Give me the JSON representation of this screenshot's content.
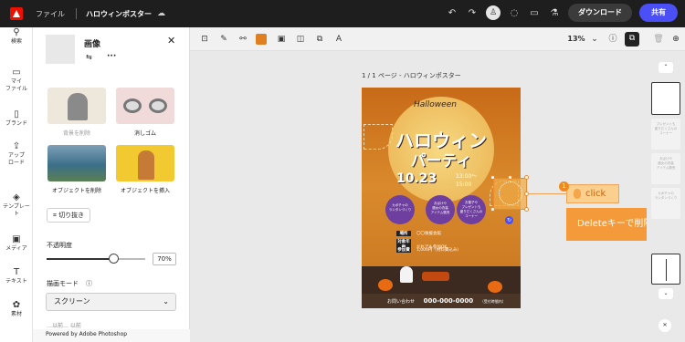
{
  "topbar": {
    "file": "ファイル",
    "title": "ハロウィンポスター",
    "download": "ダウンロード",
    "share": "共有"
  },
  "rail": [
    {
      "icon": "search-icon",
      "label": "検索"
    },
    {
      "icon": "folder-icon",
      "label": "マイ\nファイル"
    },
    {
      "icon": "brand-icon",
      "label": "ブランド"
    },
    {
      "icon": "upload-icon",
      "label": "アップ\nロード"
    },
    {
      "icon": "template-icon",
      "label": "テンプレー\nト"
    },
    {
      "icon": "media-icon",
      "label": "メディア"
    },
    {
      "icon": "text-icon",
      "label": "テキスト"
    },
    {
      "icon": "element-icon",
      "label": "素材"
    }
  ],
  "panel": {
    "title": "画像",
    "tools": [
      "背景を削除",
      "消しゴム",
      "オブジェクトを削除",
      "オブジェクトを挿入"
    ],
    "crop": "切り抜き",
    "opacity_label": "不透明度",
    "opacity_value": "70%",
    "opacity": 0.7,
    "blend_label": "描画モード",
    "blend_value": "スクリーン",
    "partial": "…以前… 以前",
    "powered": "Powered by Adobe Photoshop"
  },
  "toolbar": {
    "zoom": "13%"
  },
  "canvas": {
    "page_label": "1 / 1 ページ - ハロウィンポスター"
  },
  "poster": {
    "script": "Halloween",
    "title1": "ハロウィン",
    "title2": "パーティ",
    "date": "10.23",
    "time_a": "13:00～",
    "time_b": "15:00",
    "circles": [
      "カボチャの\nランタンづくり",
      "おばけや\n魔女の衣装\nアイテム販売",
      "お菓子や\nプレゼントも\n盛りだくさんの\nコーナー"
    ],
    "rows": [
      {
        "k": "場所",
        "v": "〇〇後援会館"
      },
      {
        "k": "対象年齢",
        "v": "だれでも参加OK"
      },
      {
        "k": "参加費",
        "v": "1,000円（材料費込み）"
      }
    ],
    "contact_label": "お問い合わせ",
    "tel": "000-000-0000",
    "contact_note": "（受付時間内）"
  },
  "annotation": {
    "number": "1",
    "click": "click",
    "delete": "Deleteキーで削除"
  },
  "pages": [
    "プレゼントも\n盛りだくさんの\nコーナー",
    "おばけや\n魔女の衣装\nアイテム販売",
    "カボチャの\nランタンづくり"
  ],
  "colors": {
    "accent": "#4a50f6",
    "orange": "#f59a3a",
    "topbar": "#1e1e1e"
  }
}
